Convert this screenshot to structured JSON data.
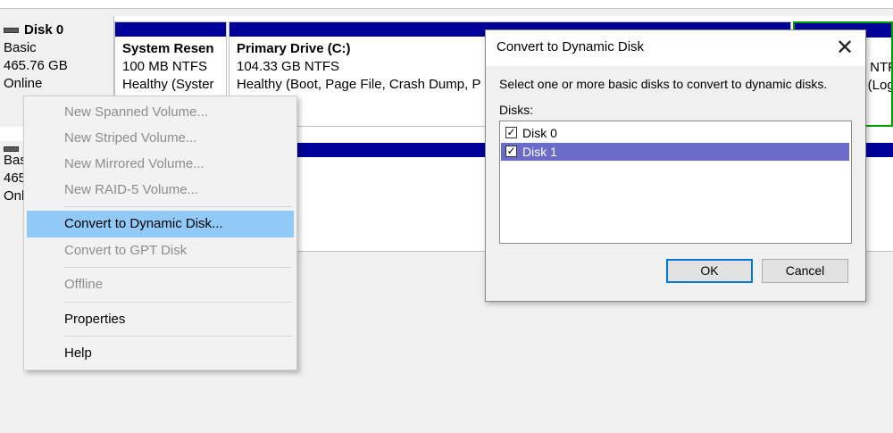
{
  "disk0": {
    "name": "Disk 0",
    "type": "Basic",
    "size": "465.76 GB",
    "status": "Online",
    "partitions": [
      {
        "name": "System Resen",
        "size": "100 MB NTFS",
        "status": "Healthy (Syster"
      },
      {
        "name": "Primary Drive  (C:)",
        "size": "104.33 GB NTFS",
        "status": "Healthy (Boot, Page File, Crash Dump, P"
      },
      {
        "name": ")",
        "size": "B NTFS",
        "status": "y (Logi"
      }
    ]
  },
  "disk1": {
    "type": "Basic",
    "size": "465",
    "status": "Onl"
  },
  "context_menu": {
    "items": [
      {
        "label": "New Spanned Volume...",
        "enabled": false
      },
      {
        "label": "New Striped Volume...",
        "enabled": false
      },
      {
        "label": "New Mirrored Volume...",
        "enabled": false
      },
      {
        "label": "New RAID-5 Volume...",
        "enabled": false
      },
      {
        "label": "Convert to Dynamic Disk...",
        "enabled": true,
        "highlighted": true
      },
      {
        "label": "Convert to GPT Disk",
        "enabled": false
      },
      {
        "label": "Offline",
        "enabled": false
      },
      {
        "label": "Properties",
        "enabled": true
      },
      {
        "label": "Help",
        "enabled": true
      }
    ]
  },
  "dialog": {
    "title": "Convert to Dynamic Disk",
    "close_glyph": "✕",
    "description": "Select one or more basic disks to convert to dynamic disks.",
    "disks_label": "Disks:",
    "disks": [
      {
        "label": "Disk 0",
        "checked": true,
        "selected": false
      },
      {
        "label": "Disk 1",
        "checked": true,
        "selected": true
      }
    ],
    "ok_label": "OK",
    "cancel_label": "Cancel"
  },
  "colors": {
    "partition_bar": "#00009a",
    "partition_bar_logical": "#00a000",
    "menu_highlight": "#91c9f7",
    "list_selection": "#6b6bc9"
  }
}
